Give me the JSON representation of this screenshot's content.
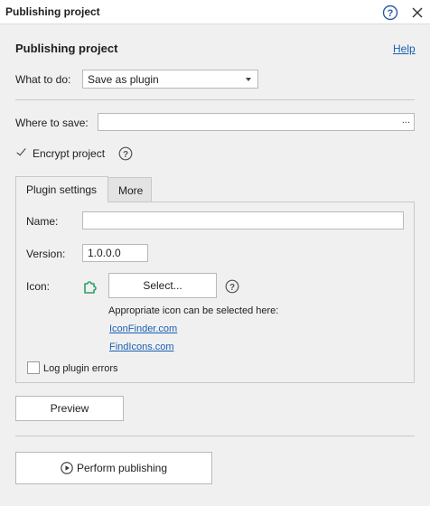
{
  "window": {
    "title": "Publishing project"
  },
  "header": {
    "heading": "Publishing project",
    "help_link": "Help"
  },
  "what_to_do": {
    "label": "What to do:",
    "selected": "Save as plugin"
  },
  "where_to_save": {
    "label": "Where to save:",
    "value": "",
    "browse": "..."
  },
  "encrypt": {
    "label": "Encrypt project",
    "checked": true
  },
  "tabs": [
    {
      "label": "Plugin settings",
      "active": true
    },
    {
      "label": "More",
      "active": false
    }
  ],
  "plugin": {
    "name_label": "Name:",
    "name_value": "",
    "version_label": "Version:",
    "version_value": "1.0.0.0",
    "icon_label": "Icon:",
    "select_button": "Select...",
    "icon_hint": "Appropriate icon can be selected here:",
    "link1": "IconFinder.com",
    "link2": "FindIcons.com",
    "log_errors_label": "Log plugin errors",
    "log_errors_checked": false
  },
  "buttons": {
    "preview": "Preview",
    "perform": "Perform publishing"
  },
  "colors": {
    "link": "#1a5fb4",
    "plugin_icon": "#2e9e6a",
    "background": "#f0f0f0"
  }
}
